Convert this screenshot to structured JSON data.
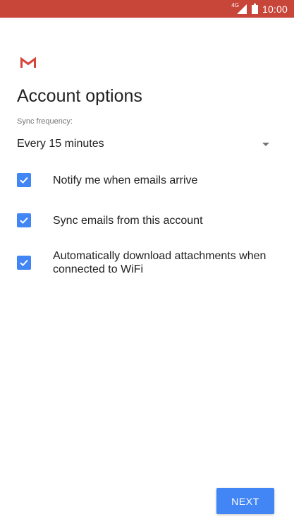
{
  "status_bar": {
    "network_type": "4G",
    "time": "10:00",
    "background_color": "#c8453a"
  },
  "app": {
    "logo_icon": "gmail-m-logo"
  },
  "page": {
    "title": "Account options",
    "sync_frequency_label": "Sync frequency:",
    "sync_frequency_value": "Every 15 minutes"
  },
  "options": [
    {
      "label": "Notify me when emails arrive",
      "checked": true
    },
    {
      "label": "Sync emails from this account",
      "checked": true
    },
    {
      "label": "Automatically download attachments when connected to WiFi",
      "checked": true
    }
  ],
  "actions": {
    "next_label": "NEXT",
    "accent_color": "#4285f4"
  }
}
